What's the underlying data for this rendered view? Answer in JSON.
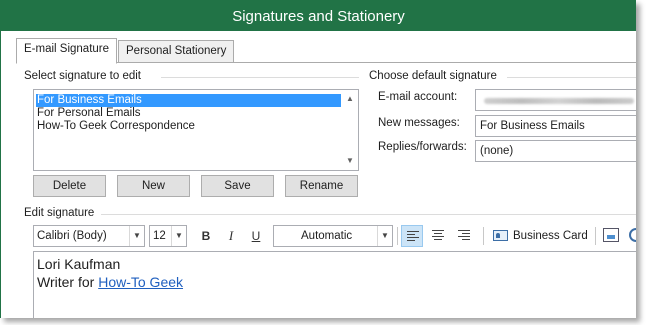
{
  "window": {
    "title": "Signatures and Stationery"
  },
  "tabs": [
    {
      "label": "E-mail Signature",
      "active": true
    },
    {
      "label": "Personal Stationery",
      "active": false
    }
  ],
  "select_signature": {
    "heading": "Select signature to edit",
    "items": [
      "For Business Emails",
      "For Personal Emails",
      "How-To Geek Correspondence"
    ],
    "selected": "For Business Emails"
  },
  "buttons": {
    "delete": "Delete",
    "new": "New",
    "save": "Save",
    "rename": "Rename"
  },
  "default_signature": {
    "heading": "Choose default signature",
    "email_account_label": "E-mail account:",
    "new_messages_label": "New messages:",
    "new_messages_value": "For Business Emails",
    "replies_label": "Replies/forwards:",
    "replies_value": "(none)"
  },
  "edit_signature": {
    "heading": "Edit signature",
    "font": "Calibri (Body)",
    "size": "12",
    "color": "Automatic",
    "bold": "B",
    "italic": "I",
    "underline": "U",
    "business_card": "Business Card",
    "alignment_selected": "left",
    "body_line1": "Lori Kaufman",
    "body_line2_prefix": "Writer for",
    "body_link": "How-To Geek"
  },
  "colors": {
    "title_bar": "#217346",
    "selection": "#3399ff",
    "link": "#1f5fbf"
  }
}
